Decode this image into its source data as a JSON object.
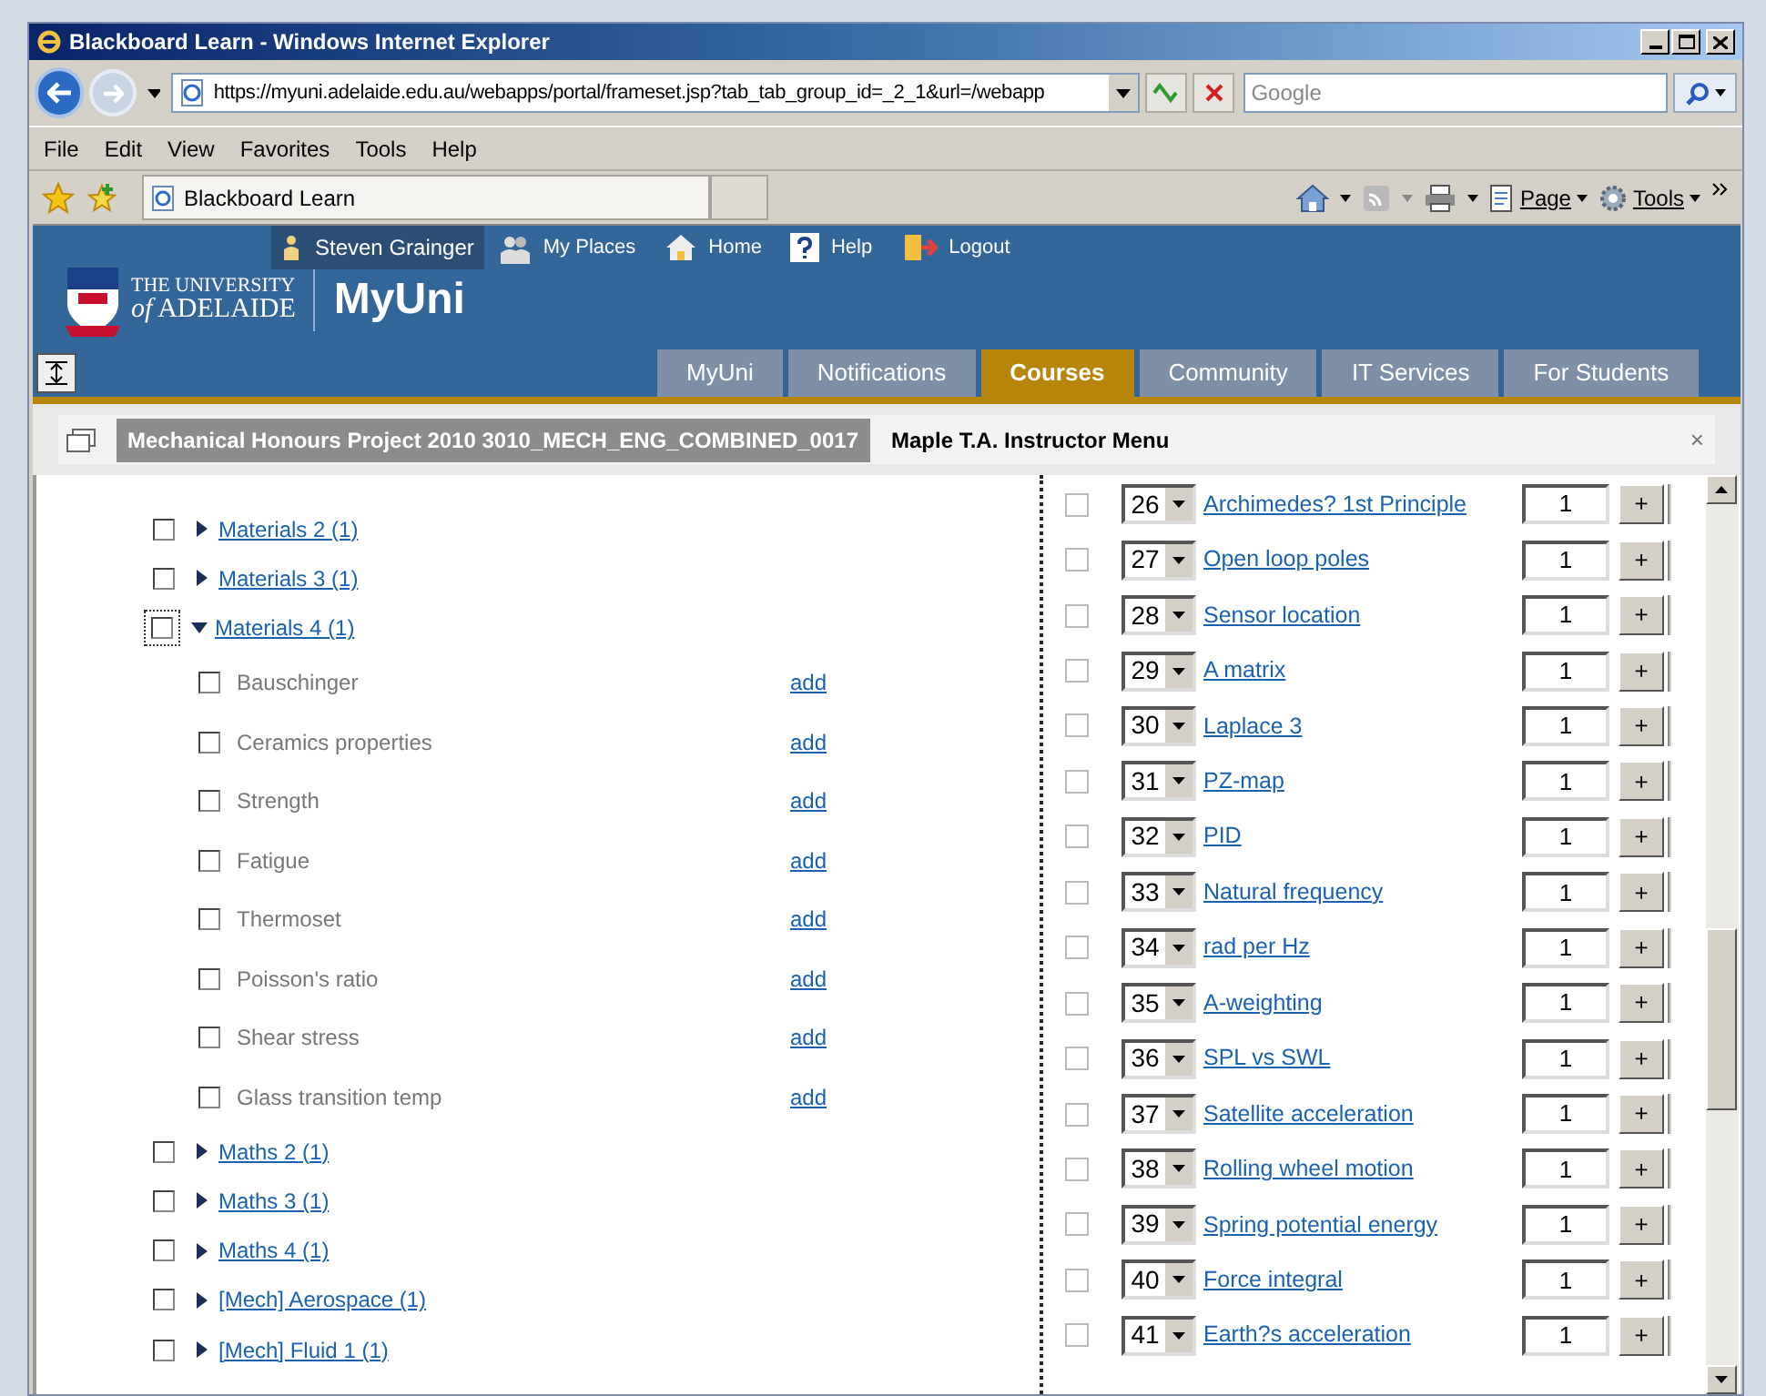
{
  "window": {
    "title": "Blackboard Learn - Windows Internet Explorer"
  },
  "address_bar": {
    "url": "https://myuni.adelaide.edu.au/webapps/portal/frameset.jsp?tab_tab_group_id=_2_1&url=/webapp"
  },
  "search": {
    "placeholder": "Google"
  },
  "menu": [
    "File",
    "Edit",
    "View",
    "Favorites",
    "Tools",
    "Help"
  ],
  "browser_tab": {
    "label": "Blackboard Learn"
  },
  "command_bar": [
    "Page",
    "Tools"
  ],
  "header": {
    "user": "Steven Grainger",
    "links": [
      "My Places",
      "Home",
      "Help",
      "Logout"
    ],
    "logo_line1": "THE UNIVERSITY",
    "logo_line2": "*of* ADELAIDE",
    "brand": "MyUni"
  },
  "tabs": [
    {
      "label": "MyUni",
      "selected": false
    },
    {
      "label": "Notifications",
      "selected": false
    },
    {
      "label": "Courses",
      "selected": true
    },
    {
      "label": "Community",
      "selected": false
    },
    {
      "label": "IT Services",
      "selected": false
    },
    {
      "label": "For Students",
      "selected": false
    }
  ],
  "course_bar": {
    "course": "Mechanical Honours Project 2010 3010_MECH_ENG_COMBINED_0017",
    "menu": "Maple T.A. Instructor Menu",
    "close": "×"
  },
  "tree": [
    {
      "label": "Materials 2 (1)",
      "checked": false,
      "expanded": false,
      "focused": false
    },
    {
      "label": "Materials 3 (1)",
      "checked": false,
      "expanded": false,
      "focused": false
    },
    {
      "label": "Materials 4 (1)",
      "checked": false,
      "expanded": true,
      "focused": true,
      "children": [
        {
          "label": "Bauschinger",
          "checked": false,
          "action": "add"
        },
        {
          "label": "Ceramics properties",
          "checked": false,
          "action": "add"
        },
        {
          "label": "Strength",
          "checked": false,
          "action": "add"
        },
        {
          "label": "Fatigue",
          "checked": false,
          "action": "add"
        },
        {
          "label": "Thermoset",
          "checked": false,
          "action": "add"
        },
        {
          "label": "Poisson's ratio",
          "checked": false,
          "action": "add"
        },
        {
          "label": "Shear stress",
          "checked": false,
          "action": "add"
        },
        {
          "label": "Glass transition temp",
          "checked": false,
          "action": "add"
        }
      ]
    },
    {
      "label": "Maths 2 (1)",
      "checked": false,
      "expanded": false,
      "focused": false
    },
    {
      "label": "Maths 3 (1)",
      "checked": false,
      "expanded": false,
      "focused": false
    },
    {
      "label": "Maths 4 (1)",
      "checked": false,
      "expanded": false,
      "focused": false
    },
    {
      "label": "[Mech] Aerospace (1)",
      "checked": false,
      "expanded": false,
      "focused": false
    },
    {
      "label": "[Mech] Fluid 1 (1)",
      "checked": false,
      "expanded": false,
      "focused": false
    }
  ],
  "questions": [
    {
      "number": "26",
      "title": "Archimedes? 1st Principle",
      "weight": "1",
      "checked": false
    },
    {
      "number": "27",
      "title": "Open loop poles",
      "weight": "1",
      "checked": false
    },
    {
      "number": "28",
      "title": "Sensor location",
      "weight": "1",
      "checked": false
    },
    {
      "number": "29",
      "title": "A matrix",
      "weight": "1",
      "checked": false
    },
    {
      "number": "30",
      "title": "Laplace 3",
      "weight": "1",
      "checked": false
    },
    {
      "number": "31",
      "title": "PZ-map",
      "weight": "1",
      "checked": false
    },
    {
      "number": "32",
      "title": "PID",
      "weight": "1",
      "checked": false
    },
    {
      "number": "33",
      "title": "Natural frequency",
      "weight": "1",
      "checked": false
    },
    {
      "number": "34",
      "title": "rad per Hz",
      "weight": "1",
      "checked": false
    },
    {
      "number": "35",
      "title": "A-weighting",
      "weight": "1",
      "checked": false
    },
    {
      "number": "36",
      "title": "SPL vs SWL",
      "weight": "1",
      "checked": false
    },
    {
      "number": "37",
      "title": "Satellite acceleration",
      "weight": "1",
      "checked": false
    },
    {
      "number": "38",
      "title": "Rolling wheel motion",
      "weight": "1",
      "checked": false
    },
    {
      "number": "39",
      "title": "Spring potential energy",
      "weight": "1",
      "checked": false
    },
    {
      "number": "40",
      "title": "Force integral",
      "weight": "1",
      "checked": false
    },
    {
      "number": "41",
      "title": "Earth?s acceleration",
      "weight": "1",
      "checked": false
    }
  ],
  "plus_label": "+"
}
